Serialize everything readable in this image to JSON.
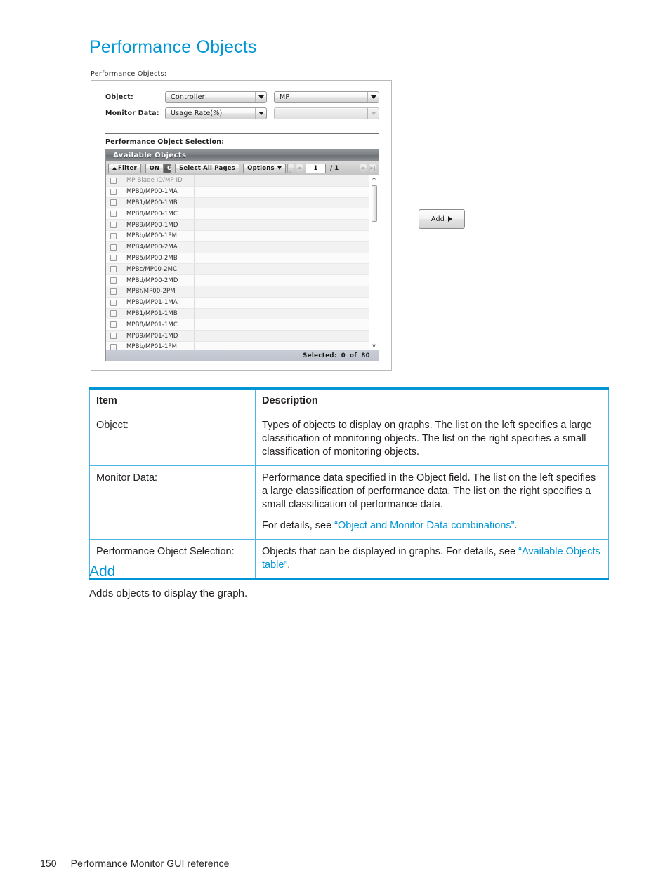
{
  "page": {
    "heading": "Performance Objects",
    "section_heading": "Add",
    "section_body": "Adds objects to display the graph.",
    "footer_page_number": "150",
    "footer_title": "Performance Monitor GUI reference",
    "accent_color": "#0096d6"
  },
  "figure": {
    "caption": "Performance Objects:",
    "fields": {
      "object_label": "Object:",
      "object_left_value": "Controller",
      "object_right_value": "MP",
      "monitor_label": "Monitor Data:",
      "monitor_left_value": "Usage Rate(%)",
      "monitor_right_value": ""
    },
    "selection_label": "Performance Object Selection:",
    "available_objects": {
      "title": "Available Objects",
      "toolbar": {
        "filter_label": "Filter",
        "on_label": "ON",
        "off_label": "OFF",
        "select_all_pages_label": "Select All Pages",
        "options_label": "Options",
        "page_value": "1",
        "page_total": "/ 1",
        "first_icon": "|<",
        "prev_icon": "<",
        "next_icon": ">",
        "last_icon": ">|"
      },
      "column_header": "MP Blade ID/MP ID",
      "rows": [
        "MPB0/MP00-1MA",
        "MPB1/MP00-1MB",
        "MPB8/MP00-1MC",
        "MPB9/MP00-1MD",
        "MPBb/MP00-1PM",
        "MPB4/MP00-2MA",
        "MPB5/MP00-2MB",
        "MPBc/MP00-2MC",
        "MPBd/MP00-2MD",
        "MPBf/MP00-2PM",
        "MPB0/MP01-1MA",
        "MPB1/MP01-1MB",
        "MPB8/MP01-1MC",
        "MPB9/MP01-1MD",
        "MPBb/MP01-1PM"
      ],
      "status_selected_label": "Selected:",
      "status_selected_count": "0",
      "status_of_label": "of",
      "status_total": "80"
    },
    "add_button_label": "Add"
  },
  "ref_table": {
    "headers": {
      "item": "Item",
      "description": "Description"
    },
    "rows": [
      {
        "item": "Object:",
        "desc_p1": "Types of objects to display on graphs. The list on the left specifies a large classification of monitoring objects. The list on the right specifies a small classification of monitoring objects."
      },
      {
        "item": "Monitor Data:",
        "desc_p1": "Performance data specified in the Object field. The list on the left specifies a large classification of performance data. The list on the right specifies a small classification of performance data.",
        "desc_p2_pre": "For details, see ",
        "desc_p2_link": "“Object and Monitor Data combinations”",
        "desc_p2_post": "."
      },
      {
        "item": "Performance Object Selection:",
        "desc_p1_pre": "Objects that can be displayed in graphs. For details, see ",
        "desc_p1_link": "“Available Objects table”",
        "desc_p1_post": "."
      }
    ]
  }
}
